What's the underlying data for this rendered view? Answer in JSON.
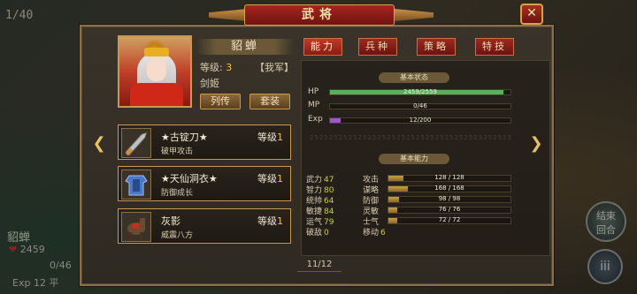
{
  "hud": {
    "turn": "1/40",
    "unit_name": "貂蝉",
    "hp_text": "2459",
    "mp_text": "0/46",
    "exp_text": "Exp 12",
    "terrain": "平",
    "end_turn_label_1": "结束",
    "end_turn_label_2": "回合",
    "menu_icon": "iii"
  },
  "window": {
    "title": "武将",
    "close_label": "✕"
  },
  "general": {
    "name": "貂蝉",
    "level_label": "等级:",
    "level": "3",
    "faction": "【我军】",
    "class": "剑姬",
    "biography_button": "列传",
    "outfit_button": "套装"
  },
  "tabs": [
    {
      "label": "能力",
      "active": true
    },
    {
      "label": "兵种",
      "active": false
    },
    {
      "label": "策略",
      "active": false
    },
    {
      "label": "特技",
      "active": false
    }
  ],
  "basic_status": {
    "heading": "基本状态",
    "bars": [
      {
        "label": "HP",
        "text": "2459/2559",
        "value": 2459,
        "max": 2559,
        "color": "#58b058"
      },
      {
        "label": "MP",
        "text": "0/46",
        "value": 0,
        "max": 46,
        "color": "#4878c8"
      },
      {
        "label": "Exp",
        "text": "12/200",
        "value": 12,
        "max": 200,
        "color": "#a058c8"
      }
    ]
  },
  "watermark": "252525252525252525252525252525252525252525",
  "basic_abilities": {
    "heading": "基本能力",
    "left": [
      {
        "name": "武力",
        "value": "47"
      },
      {
        "name": "智力",
        "value": "80"
      },
      {
        "name": "统帅",
        "value": "64"
      },
      {
        "name": "敏捷",
        "value": "84"
      },
      {
        "name": "运气",
        "value": "79"
      },
      {
        "name": "破敌",
        "value": "0"
      },
      {
        "name": "移动",
        "value": "6"
      }
    ],
    "right": [
      {
        "name": "攻击",
        "text": "128 / 128",
        "fill": 0.12
      },
      {
        "name": "谋略",
        "text": "168 / 168",
        "fill": 0.16
      },
      {
        "name": "防御",
        "text": "98 / 98",
        "fill": 0.09
      },
      {
        "name": "灵敏",
        "text": "76 / 76",
        "fill": 0.07
      },
      {
        "name": "士气",
        "text": "72 / 72",
        "fill": 0.07
      }
    ]
  },
  "equipment": [
    {
      "name": "★古锭刀★",
      "level_label": "等级",
      "level": "1",
      "desc": "破甲攻击",
      "icon": "sword-icon"
    },
    {
      "name": "★天仙洞衣★",
      "level_label": "等级",
      "level": "1",
      "desc": "防御成长",
      "icon": "armor-icon"
    },
    {
      "name": "灰影",
      "level_label": "等级",
      "level": "1",
      "desc": "威震八方",
      "icon": "horse-icon"
    }
  ],
  "pagination": "11/12"
}
